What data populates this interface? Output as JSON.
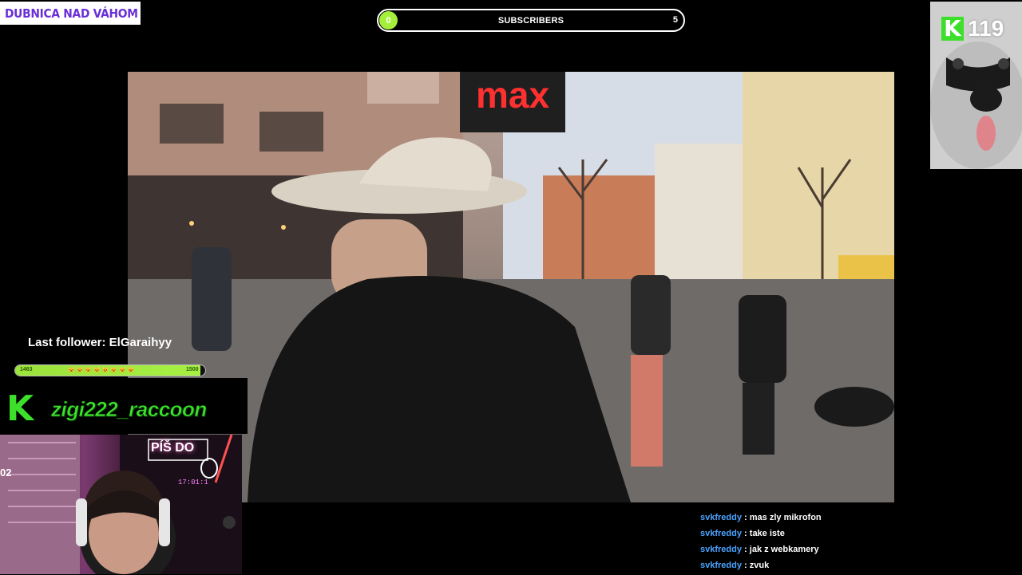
{
  "location": {
    "text": "DUBNICA NAD VÁHOM",
    "icon": "map-pin-icon",
    "color": "#6a2fd6"
  },
  "subscribers_bar": {
    "current": "0",
    "label": "SUBSCRIBERS",
    "goal": "5",
    "accent": "#a4ef3a"
  },
  "video": {
    "sign_text": "max"
  },
  "raccoon_cam": {
    "platform_letter": "K",
    "viewer_count": "119",
    "brand_color": "#3ce02a"
  },
  "follower": {
    "label": "Last follower: ElGaraihyy",
    "progress_left": "1463",
    "progress_middle": "🐱 🐱 🐱 🐱 🐱 🐱 🐱 🐱",
    "progress_right": "1500",
    "progress_fraction": 0.975
  },
  "kick": {
    "logo_letter": "K",
    "username": "zigi222_raccoon"
  },
  "webcam": {
    "sign": "PÍŠ DO",
    "clock": "17:01:1",
    "side_label": "02"
  },
  "chat": {
    "separator": ":",
    "messages": [
      {
        "user": "svkfreddy",
        "text": "mas zly mikrofon"
      },
      {
        "user": "svkfreddy",
        "text": "take iste"
      },
      {
        "user": "svkfreddy",
        "text": "jak z webkamery"
      },
      {
        "user": "svkfreddy",
        "text": "zvuk"
      }
    ]
  }
}
